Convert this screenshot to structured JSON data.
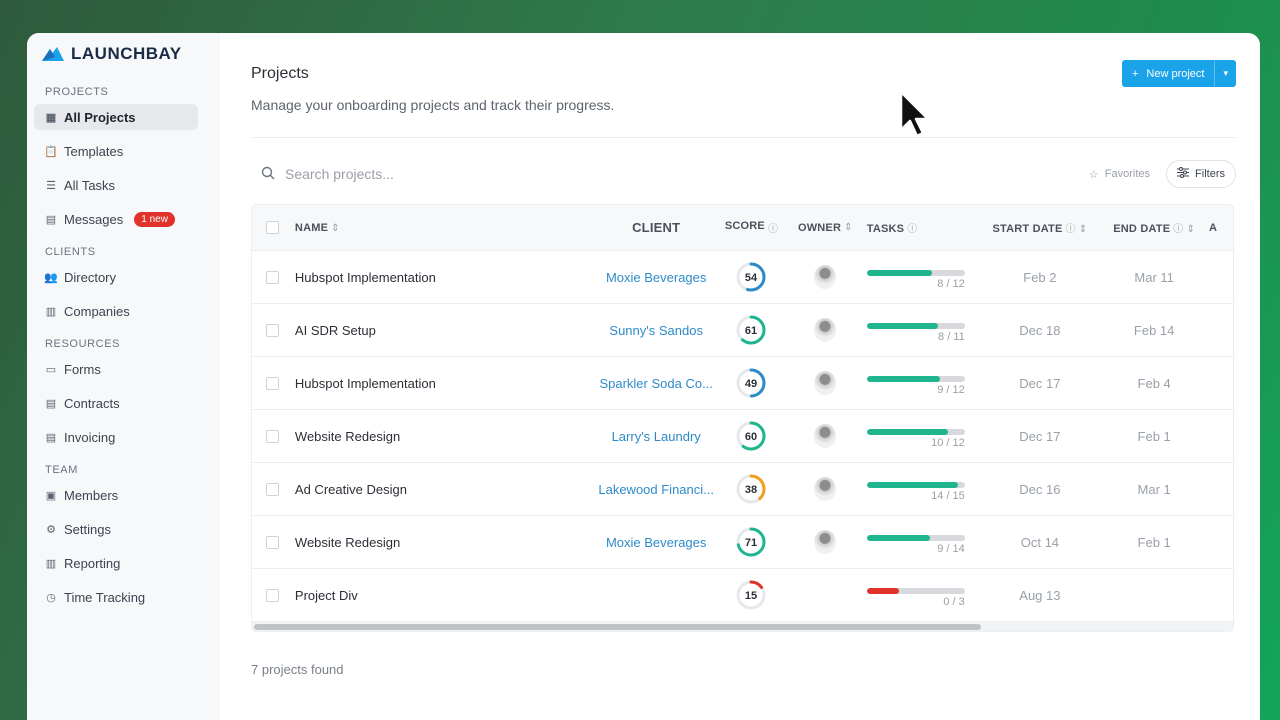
{
  "brand": {
    "name": "LAUNCHBAY",
    "accent": "#1aa3e8"
  },
  "sidebar": {
    "sections": [
      {
        "heading": "PROJECTS",
        "items": [
          {
            "label": "All Projects",
            "icon": "board-icon",
            "active": true
          },
          {
            "label": "Templates",
            "icon": "clipboard-icon"
          },
          {
            "label": "All Tasks",
            "icon": "list-icon"
          },
          {
            "label": "Messages",
            "icon": "message-icon",
            "badge": "1 new"
          }
        ]
      },
      {
        "heading": "CLIENTS",
        "items": [
          {
            "label": "Directory",
            "icon": "people-icon"
          },
          {
            "label": "Companies",
            "icon": "building-icon"
          }
        ]
      },
      {
        "heading": "RESOURCES",
        "items": [
          {
            "label": "Forms",
            "icon": "form-icon"
          },
          {
            "label": "Contracts",
            "icon": "document-icon"
          },
          {
            "label": "Invoicing",
            "icon": "invoice-icon"
          }
        ]
      },
      {
        "heading": "TEAM",
        "items": [
          {
            "label": "Members",
            "icon": "member-card-icon"
          },
          {
            "label": "Settings",
            "icon": "gear-icon"
          },
          {
            "label": "Reporting",
            "icon": "report-icon"
          },
          {
            "label": "Time Tracking",
            "icon": "clock-icon"
          }
        ]
      }
    ]
  },
  "header": {
    "title": "Projects",
    "subtitle": "Manage your onboarding projects and track their progress.",
    "new_button": "New project"
  },
  "toolbar": {
    "search_placeholder": "Search projects...",
    "favorites": "Favorites",
    "filters": "Filters"
  },
  "table": {
    "columns": {
      "name": "NAME",
      "client": "CLIENT",
      "score": "SCORE",
      "owner": "OWNER",
      "tasks": "TASKS",
      "start": "START DATE",
      "end": "END DATE",
      "a": "A"
    },
    "rows": [
      {
        "name": "Hubspot Implementation",
        "client": "Moxie Beverages",
        "score": 54,
        "score_color": "#2e8bc9",
        "tasks_done": 8,
        "tasks_total": 12,
        "tasks_label": "8 / 12",
        "bar_color": "#1fb58f",
        "start": "Feb 2",
        "end": "Mar 11",
        "owner": true
      },
      {
        "name": "AI SDR Setup",
        "client": "Sunny's Sandos",
        "score": 61,
        "score_color": "#1fb58f",
        "tasks_done": 8,
        "tasks_total": 11,
        "tasks_label": "8 / 11",
        "bar_color": "#1fb58f",
        "start": "Dec 18",
        "end": "Feb 14",
        "owner": true
      },
      {
        "name": "Hubspot Implementation",
        "client": "Sparkler Soda Co...",
        "score": 49,
        "score_color": "#2e8bc9",
        "tasks_done": 9,
        "tasks_total": 12,
        "tasks_label": "9 / 12",
        "bar_color": "#1fb58f",
        "start": "Dec 17",
        "end": "Feb 4",
        "owner": true
      },
      {
        "name": "Website Redesign",
        "client": "Larry's Laundry",
        "score": 60,
        "score_color": "#1fb58f",
        "tasks_done": 10,
        "tasks_total": 12,
        "tasks_label": "10 / 12",
        "bar_color": "#1fb58f",
        "start": "Dec 17",
        "end": "Feb 1",
        "owner": true
      },
      {
        "name": "Ad Creative Design",
        "client": "Lakewood Financi...",
        "score": 38,
        "score_color": "#f0a020",
        "tasks_done": 14,
        "tasks_total": 15,
        "tasks_label": "14 / 15",
        "bar_color": "#1fb58f",
        "start": "Dec 16",
        "end": "Mar 1",
        "owner": true
      },
      {
        "name": "Website Redesign",
        "client": "Moxie Beverages",
        "score": 71,
        "score_color": "#1fb58f",
        "tasks_done": 9,
        "tasks_total": 14,
        "tasks_label": "9 / 14",
        "bar_color": "#1fb58f",
        "start": "Oct 14",
        "end": "Feb 1",
        "owner": true
      },
      {
        "name": "Project Div",
        "client": "",
        "score": 15,
        "score_color": "#e0312b",
        "tasks_done": 1,
        "tasks_total": 3,
        "tasks_label": "0 / 3",
        "bar_color": "#e0312b",
        "start": "Aug 13",
        "end": "",
        "owner": false
      }
    ]
  },
  "footer": {
    "count_text": "7 projects found"
  }
}
